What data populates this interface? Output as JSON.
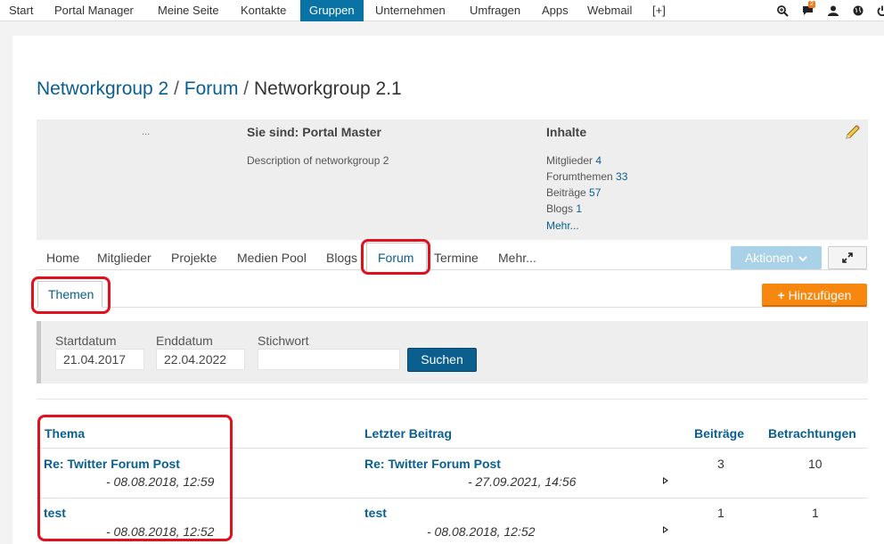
{
  "topnav": {
    "items": [
      "Start",
      "Portal Manager",
      "Meine Seite",
      "Kontakte",
      "Gruppen",
      "Unternehmen",
      "Umfragen",
      "Apps",
      "Webmail",
      "[+]"
    ],
    "active": "Gruppen",
    "notification_count": "2"
  },
  "breadcrumb": {
    "part1": "Networkgroup 2",
    "sep1": " / ",
    "part2": "Forum",
    "sep2": " / ",
    "current": "Networkgroup 2.1"
  },
  "info": {
    "ellipsis": "...",
    "role": "Sie sind: Portal Master",
    "description": "Description of networkgroup 2",
    "inhalte_title": "Inhalte",
    "stats": [
      {
        "label": "Mitglieder",
        "value": "4"
      },
      {
        "label": "Forumthemen",
        "value": "33"
      },
      {
        "label": "Beiträge",
        "value": "57"
      },
      {
        "label": "Blogs",
        "value": "1"
      }
    ],
    "mehr": "Mehr..."
  },
  "tabs": [
    "Home",
    "Mitglieder",
    "Projekte",
    "Medien Pool",
    "Blogs",
    "Forum",
    "Termine",
    "Mehr..."
  ],
  "aktionen_label": "Aktionen",
  "subtab": "Themen",
  "add_label": "Hinzufügen",
  "filter": {
    "start_label": "Startdatum",
    "start_value": "21.04.2017",
    "end_label": "Enddatum",
    "end_value": "22.04.2022",
    "keyword_label": "Stichwort",
    "keyword_value": "",
    "search_button": "Suchen"
  },
  "table": {
    "headers": [
      "Thema",
      "Letzter Beitrag",
      "Beiträge",
      "Betrachtungen"
    ],
    "rows": [
      {
        "topic": "Re: Twitter Forum Post",
        "topic_date": "- 08.08.2018, 12:59",
        "last": "Re: Twitter Forum Post",
        "last_date": "- 27.09.2021, 14:56",
        "posts": "3",
        "views": "10"
      },
      {
        "topic": "test",
        "topic_date": "- 08.08.2018, 12:52",
        "last": "test",
        "last_date": "- 08.08.2018, 12:52",
        "posts": "1",
        "views": "1"
      }
    ]
  },
  "colors": {
    "link": "#0a5f8e",
    "active_nav": "#0a73a6",
    "orange": "#f7870f",
    "annotation": "#e0101c"
  }
}
